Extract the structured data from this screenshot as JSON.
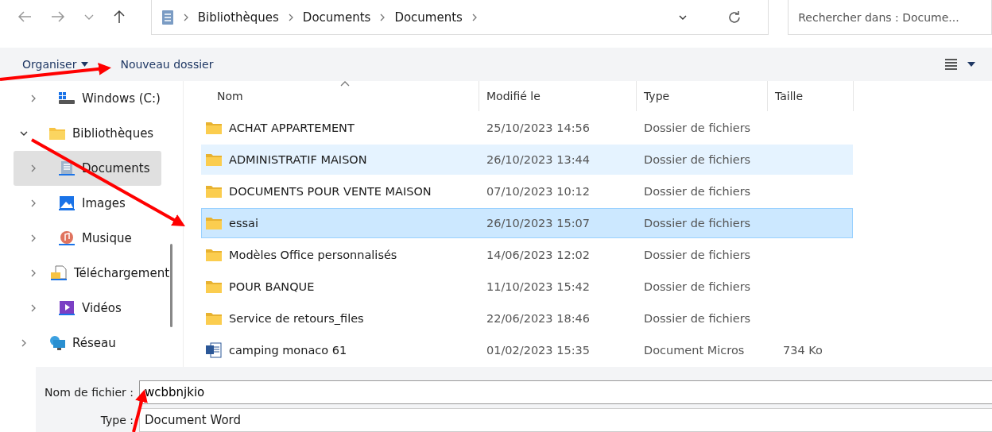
{
  "address_bar": {
    "breadcrumbs": [
      "Bibliothèques",
      "Documents",
      "Documents"
    ]
  },
  "search": {
    "placeholder": "Rechercher dans : Docume..."
  },
  "toolbar": {
    "organize": "Organiser",
    "new_folder": "Nouveau dossier"
  },
  "sidebar": {
    "items": [
      {
        "children": [
          {
            "label": "Windows (C:)",
            "kind": "drive",
            "expanded": false,
            "selected": false
          }
        ]
      },
      {
        "label": "Bibliothèques",
        "kind": "folder",
        "expanded": true,
        "selected": false,
        "children": [
          {
            "label": "Documents",
            "kind": "documents",
            "expanded": false,
            "selected": true
          },
          {
            "label": "Images",
            "kind": "images",
            "expanded": false,
            "selected": false
          },
          {
            "label": "Musique",
            "kind": "music",
            "expanded": false,
            "selected": false
          },
          {
            "label": "Téléchargement",
            "kind": "downloads",
            "expanded": false,
            "selected": false
          },
          {
            "label": "Vidéos",
            "kind": "videos",
            "expanded": false,
            "selected": false
          }
        ]
      },
      {
        "label": "Réseau",
        "kind": "network",
        "expanded": false,
        "selected": false
      }
    ]
  },
  "table": {
    "columns": [
      "Nom",
      "Modifié le",
      "Type",
      "Taille"
    ],
    "rows": [
      {
        "kind": "folder",
        "name": "ACHAT APPARTEMENT",
        "modified": "25/10/2023 14:56",
        "type": "Dossier de fichiers",
        "selected": false,
        "hovered": false
      },
      {
        "kind": "folder",
        "name": "ADMINISTRATIF MAISON",
        "modified": "26/10/2023 13:44",
        "type": "Dossier de fichiers",
        "selected": false,
        "hovered": true
      },
      {
        "kind": "folder",
        "name": "DOCUMENTS POUR VENTE MAISON",
        "modified": "07/10/2023 10:12",
        "type": "Dossier de fichiers",
        "selected": false,
        "hovered": false
      },
      {
        "kind": "folder",
        "name": "essai",
        "modified": "26/10/2023 15:07",
        "type": "Dossier de fichiers",
        "selected": true,
        "hovered": false
      },
      {
        "kind": "folder",
        "name": "Modèles Office personnalisés",
        "modified": "14/06/2023 12:02",
        "type": "Dossier de fichiers",
        "selected": false,
        "hovered": false
      },
      {
        "kind": "folder",
        "name": "POUR BANQUE",
        "modified": "11/10/2023 15:42",
        "type": "Dossier de fichiers",
        "selected": false,
        "hovered": false
      },
      {
        "kind": "folder",
        "name": "Service de retours_files",
        "modified": "22/06/2023 18:46",
        "type": "Dossier de fichiers",
        "selected": false,
        "hovered": false
      },
      {
        "kind": "word",
        "name": "camping monaco 61",
        "modified": "01/02/2023 15:35",
        "type": "Document Micros",
        "size": "734 Ko",
        "selected": false,
        "hovered": false
      }
    ]
  },
  "save_form": {
    "file_name_label": "Nom de fichier :",
    "file_name": "wcbbnjkio",
    "type_label": "Type :",
    "type_value": "Document Word"
  }
}
